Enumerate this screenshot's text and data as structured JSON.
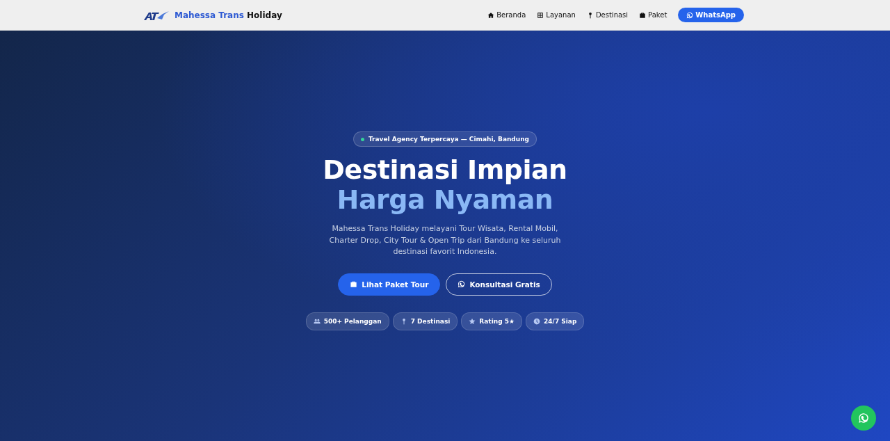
{
  "header": {
    "brand": {
      "accent": "Mahessa Trans",
      "rest": "Holiday"
    },
    "nav": [
      {
        "kind": "home",
        "label": "Beranda"
      },
      {
        "kind": "grid",
        "label": "Layanan"
      },
      {
        "kind": "pin",
        "label": "Destinasi"
      },
      {
        "kind": "bag",
        "label": "Paket"
      }
    ],
    "cta": {
      "kind": "whatsapp",
      "label": "WhatsApp"
    }
  },
  "hero": {
    "badge": "Travel Agency Terpercaya — Cimahi, Bandung",
    "title_line1": "Destinasi Impian",
    "title_line2": "Harga Nyaman",
    "description": "Mahessa Trans Holiday melayani Tour Wisata, Rental Mobil, Charter Drop, City Tour & Open Trip dari Bandung ke seluruh destinasi favorit Indonesia.",
    "buttons": [
      {
        "kind": "bag",
        "label": "Lihat Paket Tour"
      },
      {
        "kind": "whatsapp",
        "label": "Konsultasi Gratis"
      }
    ],
    "stats": [
      {
        "kind": "users",
        "label": "500+ Pelanggan"
      },
      {
        "kind": "pin",
        "label": "7 Destinasi"
      },
      {
        "kind": "star",
        "label": "Rating 5★"
      },
      {
        "kind": "clock",
        "label": "24/7 Siap"
      }
    ]
  },
  "floating_button": {
    "kind": "whatsapp"
  }
}
